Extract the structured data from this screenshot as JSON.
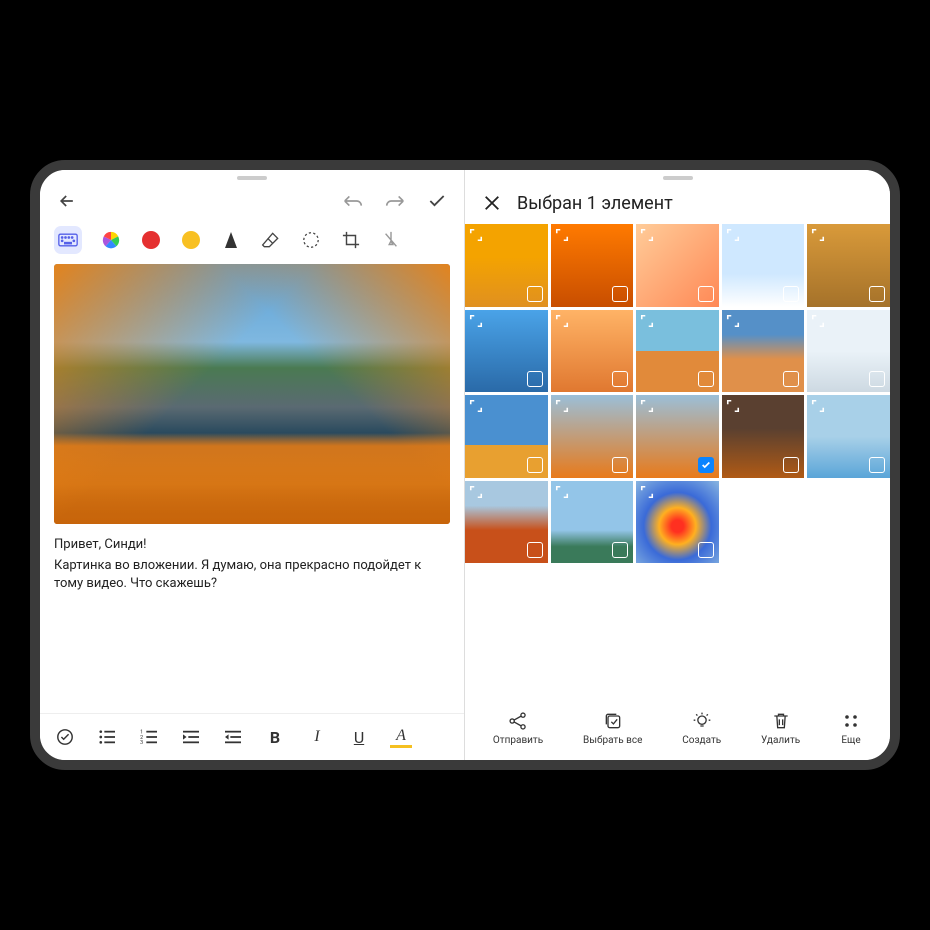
{
  "notes": {
    "greeting": "Привет, Синди!",
    "body": "Картинка во вложении. Я думаю, она прекрасно подойдет к тому видео. Что скажешь?",
    "tools": {
      "keyboard": "keyboard-icon",
      "colorwheel": "color-wheel-icon",
      "red": "#e53030",
      "yellow": "#f8c022",
      "pen": "pen-icon",
      "eraser": "eraser-icon",
      "lasso": "lasso-icon",
      "crop": "crop-icon",
      "stylus": "stylus-off-icon"
    },
    "header": {
      "back": "back-icon",
      "undo": "undo-icon",
      "redo": "redo-icon",
      "confirm": "confirm-icon"
    },
    "format": {
      "check": "checkbox-icon",
      "ul": "bullet-list-icon",
      "ol": "ordered-list-icon",
      "indent": "indent-list-icon",
      "outdent": "outdent-list-icon",
      "bold": "B",
      "italic": "I",
      "underline": "U",
      "highlight": "A"
    }
  },
  "gallery": {
    "title": "Выбран 1 элемент",
    "thumbs": [
      {
        "c": "t0",
        "sel": false
      },
      {
        "c": "t1",
        "sel": false
      },
      {
        "c": "t2",
        "sel": false
      },
      {
        "c": "t3",
        "sel": false
      },
      {
        "c": "t4",
        "sel": false
      },
      {
        "c": "t5",
        "sel": false
      },
      {
        "c": "t6",
        "sel": false
      },
      {
        "c": "t7",
        "sel": false
      },
      {
        "c": "t8",
        "sel": false
      },
      {
        "c": "t9",
        "sel": false
      },
      {
        "c": "t10",
        "sel": false
      },
      {
        "c": "t11",
        "sel": false
      },
      {
        "c": "t11",
        "sel": true
      },
      {
        "c": "t12",
        "sel": false
      },
      {
        "c": "t13",
        "sel": false
      },
      {
        "c": "t14",
        "sel": false
      },
      {
        "c": "t15",
        "sel": false
      },
      {
        "c": "t16",
        "sel": false
      }
    ],
    "actions": {
      "send": "Отправить",
      "selectAll": "Выбрать все",
      "create": "Создать",
      "delete": "Удалить",
      "more": "Еще"
    }
  }
}
